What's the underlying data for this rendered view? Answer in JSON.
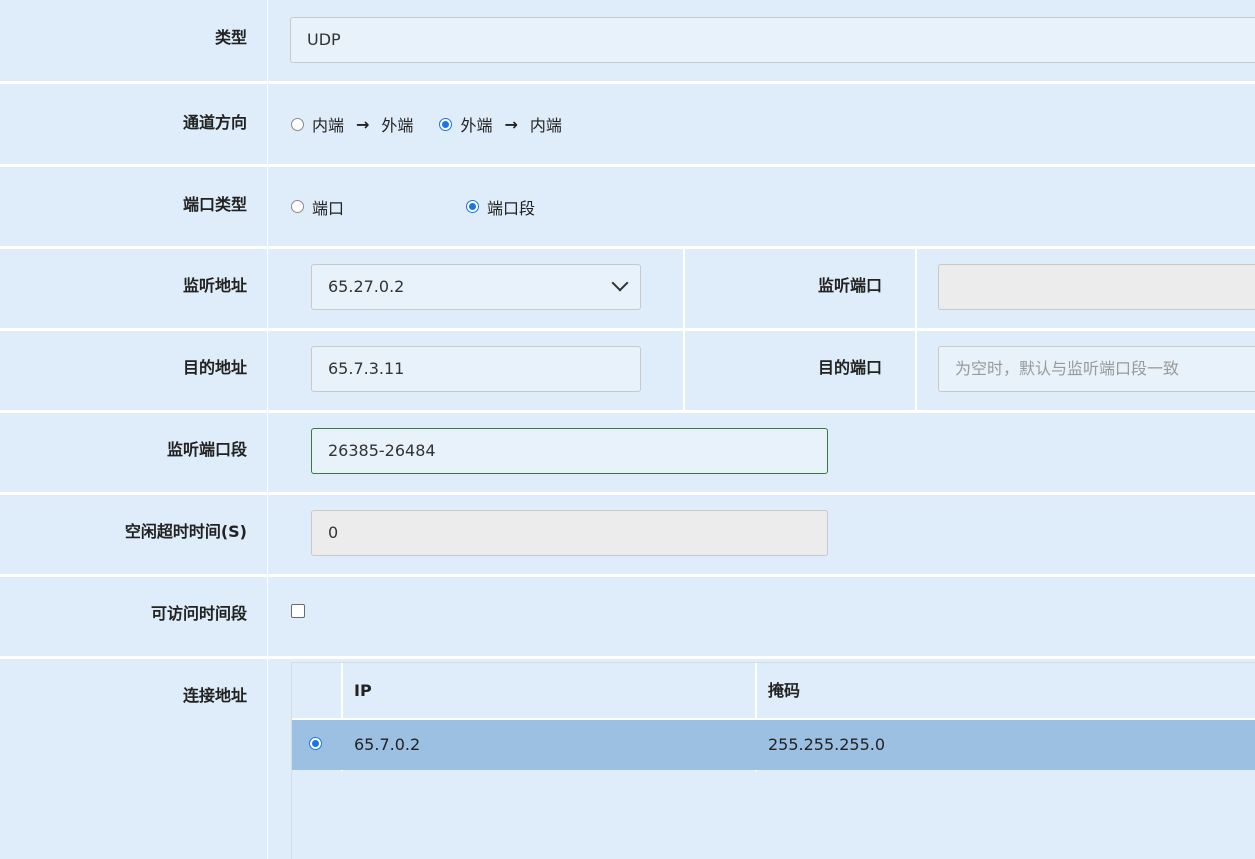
{
  "labels": {
    "type": "类型",
    "direction": "通道方向",
    "port_type": "端口类型",
    "listen_addr": "监听地址",
    "listen_port": "监听端口",
    "dest_addr": "目的地址",
    "dest_port": "目的端口",
    "listen_port_range": "监听端口段",
    "idle_timeout": "空闲超时时间(S)",
    "access_time": "可访问时间段",
    "conn_addr": "连接地址"
  },
  "fields": {
    "type_value": "UDP",
    "direction_options": [
      {
        "label_from": "内端",
        "label_to": "外端",
        "selected": false
      },
      {
        "label_from": "外端",
        "label_to": "内端",
        "selected": true
      }
    ],
    "direction_arrow": "→",
    "port_type_options": [
      {
        "label": "端口",
        "selected": false
      },
      {
        "label": "端口段",
        "selected": true
      }
    ],
    "listen_addr_value": "65.27.0.2",
    "listen_port_value": "",
    "dest_addr_value": "65.7.3.11",
    "dest_port_placeholder": "为空时，默认与监听端口段一致",
    "listen_port_range_value": "26385-26484",
    "idle_timeout_value": "0",
    "access_time_checked": false
  },
  "conn_table": {
    "headers": [
      "IP",
      "掩码"
    ],
    "rows": [
      {
        "selected": true,
        "ip": "65.7.0.2",
        "mask": "255.255.255.0"
      }
    ]
  },
  "colors": {
    "row_bg": "#deedf9",
    "selected_row": "#9cc0e2",
    "radio_accent": "#1a73e8",
    "focus_border": "#3b7a3b"
  },
  "icons": {
    "dropdown": "chevron-down-icon",
    "radio": "radio-icon",
    "checkbox": "checkbox-icon"
  }
}
